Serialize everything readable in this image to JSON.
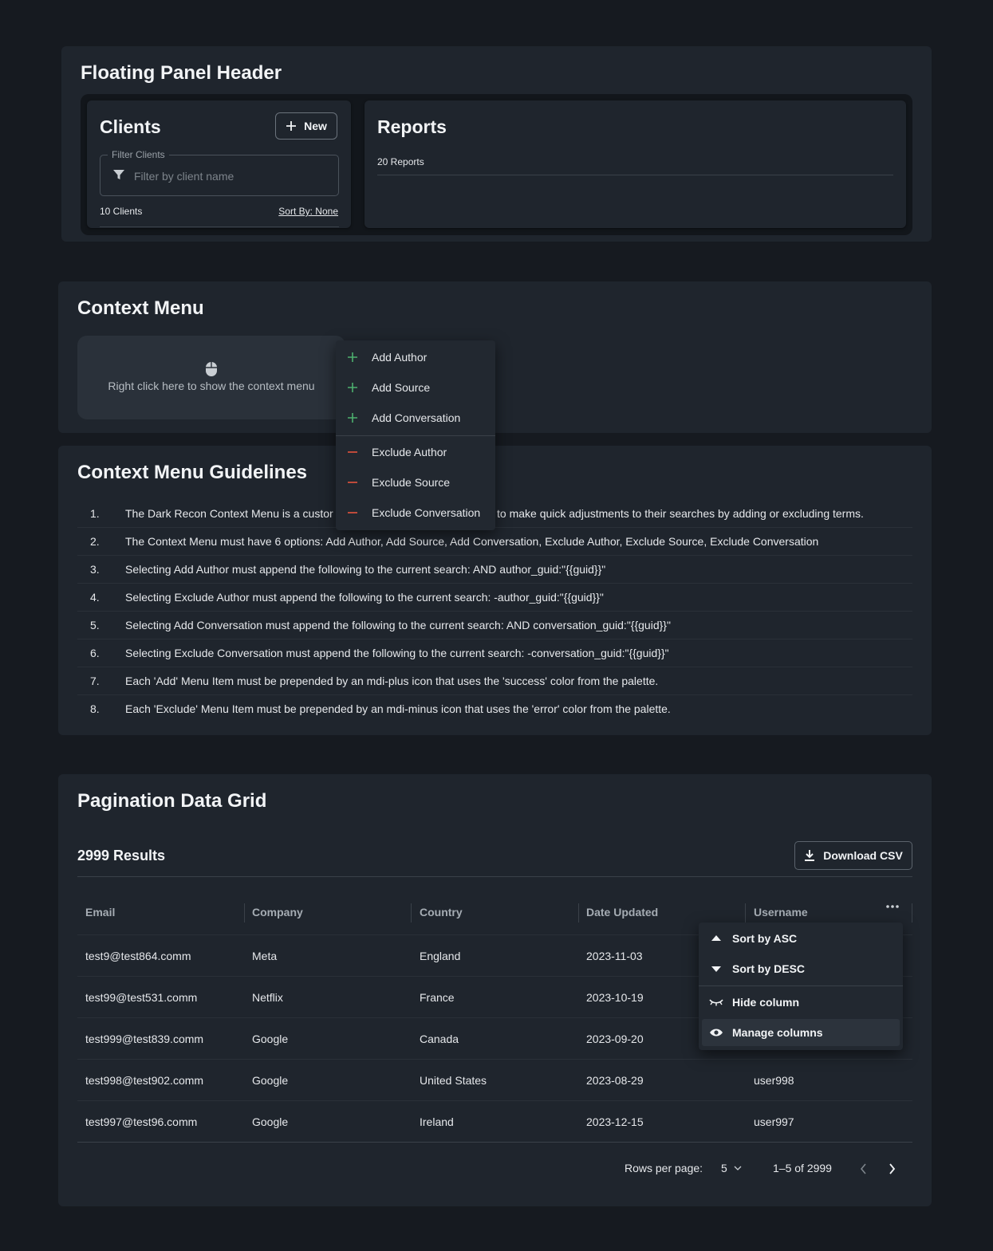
{
  "floating_panel": {
    "title": "Floating Panel Header",
    "clients": {
      "title": "Clients",
      "new_label": "New",
      "filter_label": "Filter Clients",
      "filter_placeholder": "Filter by client name",
      "count": "10 Clients",
      "sort": "Sort By: None"
    },
    "reports": {
      "title": "Reports",
      "count": "20 Reports"
    }
  },
  "context_menu": {
    "title": "Context Menu",
    "area_text": "Right click here to show the context menu",
    "items": [
      {
        "label": "Add Author",
        "icon": "plus-icon"
      },
      {
        "label": "Add Source",
        "icon": "plus-icon"
      },
      {
        "label": "Add Conversation",
        "icon": "plus-icon"
      },
      {
        "label": "Exclude Author",
        "icon": "minus-icon"
      },
      {
        "label": "Exclude Source",
        "icon": "minus-icon"
      },
      {
        "label": "Exclude Conversation",
        "icon": "minus-icon"
      }
    ],
    "success_color": "#4caf6e",
    "error_color": "#e5533d"
  },
  "guidelines": {
    "title": "Context Menu Guidelines",
    "items": [
      {
        "num": "1.",
        "text": "The Dark Recon Context Menu is a custor",
        "text_tail": "to make quick adjustments to their searches by adding or excluding terms."
      },
      {
        "num": "2.",
        "text": "The Context Menu must have 6 options: Add Author, Add Source, Add Conversation, Exclude Author, Exclude Source, Exclude Conversation"
      },
      {
        "num": "3.",
        "text": "Selecting Add Author must append the following to the current search: AND author_guid:\"{{guid}}\""
      },
      {
        "num": "4.",
        "text": "Selecting Exclude Author must append the following to the current search: -author_guid:\"{{guid}}\""
      },
      {
        "num": "5.",
        "text": "Selecting Add Conversation must append the following to the current search: AND conversation_guid:\"{{guid}}\""
      },
      {
        "num": "6.",
        "text": "Selecting Exclude Conversation must append the following to the current search: -conversation_guid:\"{{guid}}\""
      },
      {
        "num": "7.",
        "text": "Each 'Add' Menu Item must be prepended by an mdi-plus icon that uses the 'success' color from the palette."
      },
      {
        "num": "8.",
        "text": "Each 'Exclude' Menu Item must be prepended by an mdi-minus icon that uses the 'error' color from the palette."
      }
    ]
  },
  "data_grid": {
    "title": "Pagination Data Grid",
    "results": "2999 Results",
    "download_label": "Download CSV",
    "columns": [
      "Email",
      "Company",
      "Country",
      "Date Updated",
      "Username"
    ],
    "rows": [
      [
        "test9@test864.comm",
        "Meta",
        "England",
        "2023-11-03",
        ""
      ],
      [
        "test99@test531.comm",
        "Netflix",
        "France",
        "2023-10-19",
        ""
      ],
      [
        "test999@test839.comm",
        "Google",
        "Canada",
        "2023-09-20",
        ""
      ],
      [
        "test998@test902.comm",
        "Google",
        "United States",
        "2023-08-29",
        "user998"
      ],
      [
        "test997@test96.comm",
        "Google",
        "Ireland",
        "2023-12-15",
        "user997"
      ]
    ],
    "column_menu": [
      {
        "label": "Sort by ASC",
        "icon": "sort-asc-icon"
      },
      {
        "label": "Sort by DESC",
        "icon": "sort-desc-icon"
      },
      {
        "label": "Hide column",
        "icon": "eye-closed-icon"
      },
      {
        "label": "Manage columns",
        "icon": "eye-icon"
      }
    ],
    "pagination": {
      "rows_per_page_label": "Rows per page:",
      "rows_per_page": "5",
      "range": "1–5 of 2999"
    }
  }
}
